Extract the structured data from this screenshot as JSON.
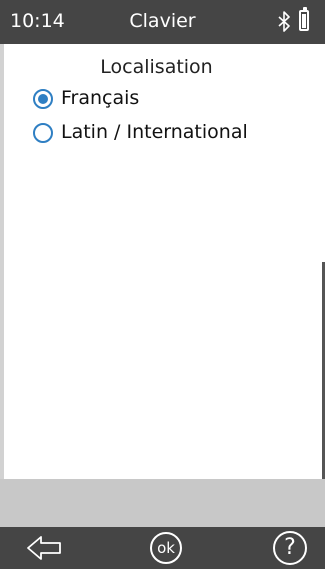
{
  "status_bar": {
    "time": "10:14",
    "title": "Clavier",
    "bluetooth_icon": "bluetooth-icon",
    "battery_icon": "battery-icon"
  },
  "content": {
    "heading": "Localisation",
    "options": [
      {
        "label": "Français",
        "selected": true
      },
      {
        "label": "Latin / International",
        "selected": false
      }
    ]
  },
  "nav": {
    "back_icon": "back-arrow-icon",
    "ok_label": "ok",
    "help_label": "?"
  },
  "colors": {
    "bar": "#454545",
    "accent": "#2f7fc3",
    "footer": "#c8c8c8"
  }
}
